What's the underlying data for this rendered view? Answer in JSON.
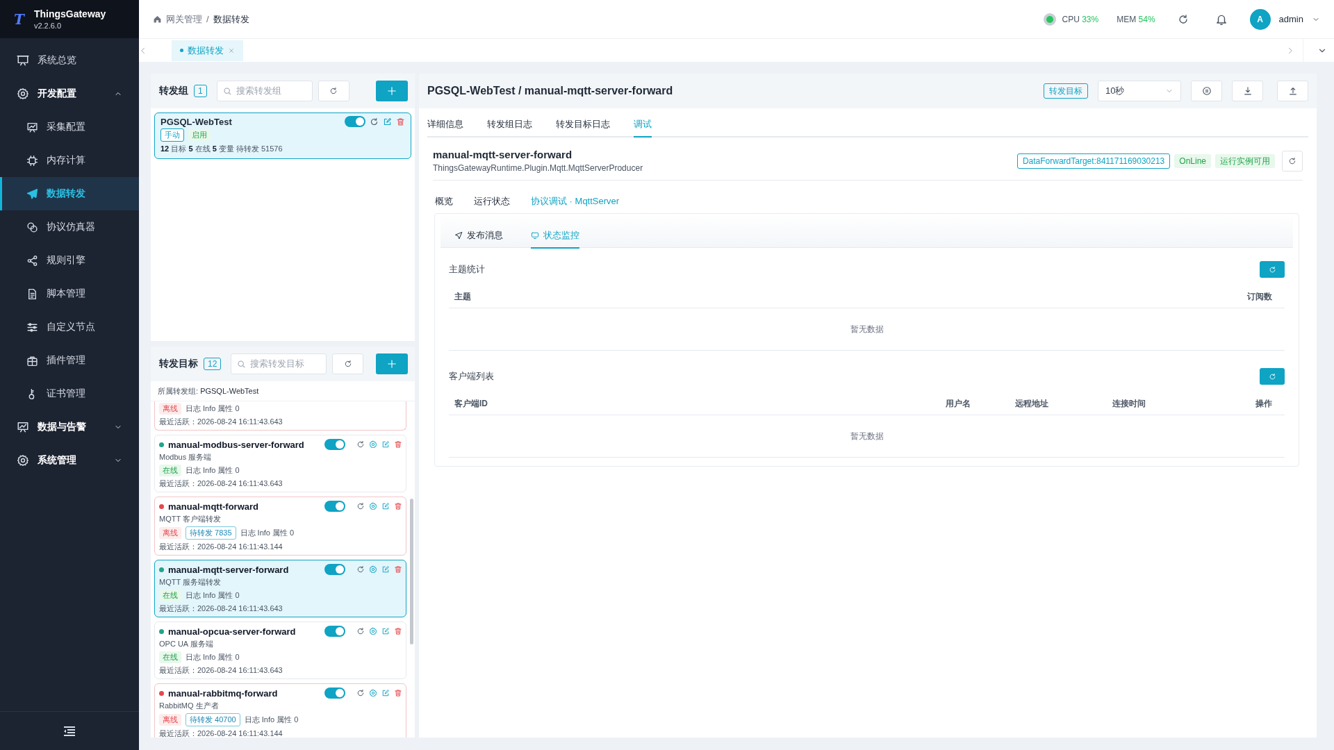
{
  "sidebar": {
    "brand": {
      "logo": "T",
      "name": "ThingsGateway",
      "version": "v2.2.6.0"
    },
    "items": [
      {
        "label": "系统总览",
        "kind": "item",
        "selected": false
      },
      {
        "label": "开发配置",
        "kind": "group",
        "expanded": true,
        "children": [
          {
            "label": "采集配置",
            "selected": false
          },
          {
            "label": "内存计算",
            "selected": false
          },
          {
            "label": "数据转发",
            "selected": true
          },
          {
            "label": "协议仿真器",
            "selected": false
          },
          {
            "label": "规则引擎",
            "selected": false
          },
          {
            "label": "脚本管理",
            "selected": false
          },
          {
            "label": "自定义节点",
            "selected": false
          },
          {
            "label": "插件管理",
            "selected": false
          },
          {
            "label": "证书管理",
            "selected": false
          }
        ]
      },
      {
        "label": "数据与告警",
        "kind": "group",
        "expanded": false
      },
      {
        "label": "系统管理",
        "kind": "group",
        "expanded": false
      }
    ]
  },
  "header": {
    "breadcrumb": [
      "网关管理",
      "数据转发"
    ],
    "breadcrumb_separator": "/",
    "cpu": {
      "label": "CPU",
      "value": "33%"
    },
    "mem": {
      "label": "MEM",
      "value": "54%"
    },
    "avatar": "A",
    "user": "admin"
  },
  "page_tabs": [
    {
      "label": "数据转发",
      "selected": true
    }
  ],
  "groups_panel": {
    "title": "转发组",
    "count": "1",
    "search": {
      "placeholder": "搜索转发组"
    },
    "groups": [
      {
        "name": "PGSQL-WebTest",
        "enabled": true,
        "selected": true,
        "tags": [
          {
            "text": "手动",
            "kind": "outline"
          },
          {
            "text": "启用",
            "kind": "success"
          }
        ],
        "stats": "**12** 目标 **5** 在线 **5** 变量 待转发 51576"
      }
    ]
  },
  "targets_panel": {
    "title": "转发目标",
    "count": "12",
    "search": {
      "placeholder": "搜索转发目标"
    },
    "filter_label": "所属转发组:",
    "filter_value": "PGSQL-WebTest",
    "targets": [
      {
        "kind": "cut",
        "online": false,
        "selected": false,
        "status": "离线",
        "info": "日志 Info 属性 0",
        "last_active": "最近活跃：2026-08-24 16:11:43.643"
      },
      {
        "kind": "full",
        "name": "manual-modbus-server-forward",
        "desc": "Modbus 服务端",
        "online": true,
        "enabled": true,
        "selected": false,
        "status": "在线",
        "info": "日志 Info 属性 0",
        "last_active": "最近活跃：2026-08-24 16:11:43.643"
      },
      {
        "kind": "full",
        "name": "manual-mqtt-forward",
        "desc": "MQTT 客户端转发",
        "online": false,
        "enabled": true,
        "selected": false,
        "status": "离线",
        "pending": "待转发 7835",
        "info": "日志 Info 属性 0",
        "last_active": "最近活跃：2026-08-24 16:11:43.144"
      },
      {
        "kind": "full",
        "name": "manual-mqtt-server-forward",
        "desc": "MQTT 服务端转发",
        "online": true,
        "enabled": true,
        "selected": true,
        "status": "在线",
        "info": "日志 Info 属性 0",
        "last_active": "最近活跃：2026-08-24 16:11:43.643"
      },
      {
        "kind": "full",
        "name": "manual-opcua-server-forward",
        "desc": "OPC UA 服务端",
        "online": true,
        "enabled": true,
        "selected": false,
        "status": "在线",
        "info": "日志 Info 属性 0",
        "last_active": "最近活跃：2026-08-24 16:11:43.643"
      },
      {
        "kind": "full",
        "name": "manual-rabbitmq-forward",
        "desc": "RabbitMQ 生产者",
        "online": false,
        "enabled": true,
        "selected": false,
        "status": "离线",
        "pending": "待转发 40700",
        "info": "日志 Info 属性 0",
        "last_active": "最近活跃：2026-08-24 16:11:43.144"
      }
    ]
  },
  "detail": {
    "title": "PGSQL-WebTest / manual-mqtt-server-forward",
    "tag": "转发目标",
    "interval": "10秒",
    "tabs": [
      {
        "label": "详细信息",
        "selected": false
      },
      {
        "label": "转发组日志",
        "selected": false
      },
      {
        "label": "转发目标日志",
        "selected": false
      },
      {
        "label": "调试",
        "selected": true
      }
    ],
    "name": "manual-mqtt-server-forward",
    "type": "ThingsGatewayRuntime.Plugin.Mqtt.MqttServerProducer",
    "badges": [
      {
        "text": "DataForwardTarget:841171169030213",
        "kind": "outline"
      },
      {
        "text": "OnLine",
        "kind": "success"
      },
      {
        "text": "运行实例可用",
        "kind": "success"
      }
    ],
    "sub_tabs": [
      {
        "label": "概览",
        "selected": false
      },
      {
        "label": "运行状态",
        "selected": false
      },
      {
        "label": "协议调试 · MqttServer",
        "selected": true
      }
    ],
    "inner_tabs": [
      {
        "label": "发布消息",
        "selected": false
      },
      {
        "label": "状态监控",
        "selected": true
      }
    ],
    "sections": [
      {
        "title": "主题统计",
        "columns": [
          "主题",
          "订阅数"
        ],
        "empty": "暂无数据"
      },
      {
        "title": "客户端列表",
        "columns": [
          "客户端ID",
          "用户名",
          "远程地址",
          "连接时间",
          "操作"
        ],
        "empty": "暂无数据"
      }
    ]
  }
}
